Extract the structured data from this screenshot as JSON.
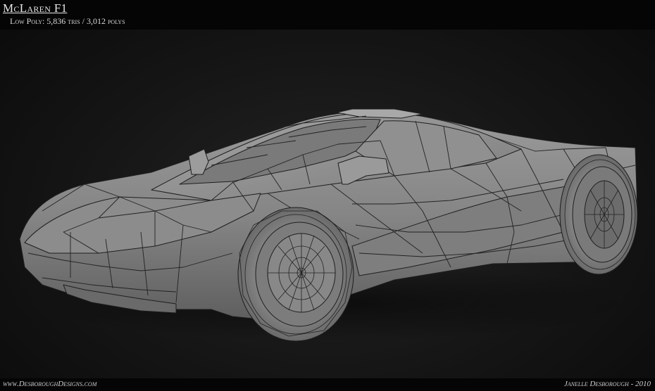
{
  "header": {
    "title": "McLaren F1",
    "subtitle": "Low Poly: 5,836 tris / 3,012 polys"
  },
  "footer": {
    "website": "www.DesboroughDesigns.com",
    "credit": "Janelle Desborough - 2010"
  },
  "colors": {
    "background": "#151515",
    "model": "#8a8a8a",
    "wire": "#1e1e1e"
  },
  "image": {
    "subject": "wireframe-car-model"
  }
}
